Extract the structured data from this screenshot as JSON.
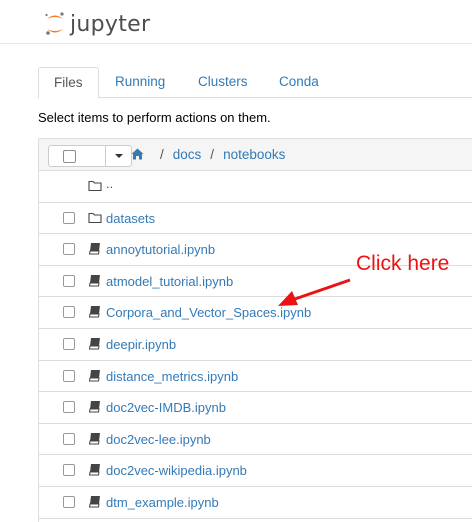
{
  "header": {
    "logo_text": "jupyter"
  },
  "tabs": [
    {
      "label": "Files",
      "active": true
    },
    {
      "label": "Running",
      "active": false
    },
    {
      "label": "Clusters",
      "active": false
    },
    {
      "label": "Conda",
      "active": false
    }
  ],
  "instructions": "Select items to perform actions on them.",
  "breadcrumb": {
    "separator": "/",
    "items": [
      "docs",
      "notebooks"
    ]
  },
  "files": [
    {
      "name": "..",
      "type": "parent"
    },
    {
      "name": "datasets",
      "type": "folder"
    },
    {
      "name": "annoytutorial.ipynb",
      "type": "notebook"
    },
    {
      "name": "atmodel_tutorial.ipynb",
      "type": "notebook"
    },
    {
      "name": "Corpora_and_Vector_Spaces.ipynb",
      "type": "notebook"
    },
    {
      "name": "deepir.ipynb",
      "type": "notebook"
    },
    {
      "name": "distance_metrics.ipynb",
      "type": "notebook"
    },
    {
      "name": "doc2vec-IMDB.ipynb",
      "type": "notebook"
    },
    {
      "name": "doc2vec-lee.ipynb",
      "type": "notebook"
    },
    {
      "name": "doc2vec-wikipedia.ipynb",
      "type": "notebook"
    },
    {
      "name": "dtm_example.ipynb",
      "type": "notebook"
    }
  ],
  "annotation": {
    "text": "Click here",
    "color": "#ee1111"
  },
  "colors": {
    "link": "#337ab7",
    "logo_orange": "#f37726"
  }
}
